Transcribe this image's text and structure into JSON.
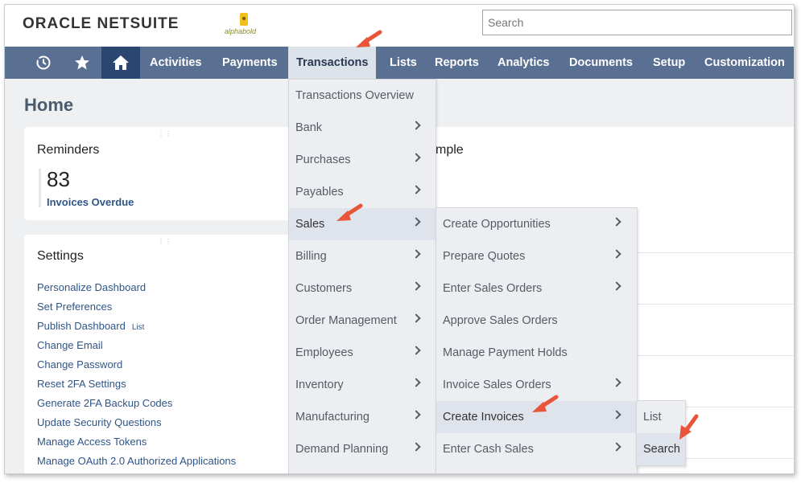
{
  "header": {
    "logo": "ORACLE NETSUITE",
    "partner_logo": "alphabold",
    "search_placeholder": "Search"
  },
  "nav": {
    "items": [
      "Activities",
      "Payments",
      "Transactions",
      "Lists",
      "Reports",
      "Analytics",
      "Documents",
      "Setup",
      "Customization"
    ],
    "active": "Transactions",
    "icons": [
      "recent-icon",
      "star-icon",
      "home-icon"
    ]
  },
  "page": {
    "title": "Home",
    "reminders": {
      "title": "Reminders",
      "count": "83",
      "label": "Invoices Overdue"
    },
    "settings": {
      "title": "Settings",
      "links": [
        "Personalize Dashboard",
        "Set Preferences",
        "Publish Dashboard",
        "Change Email",
        "Change Password",
        "Reset 2FA Settings",
        "Generate 2FA Backup Codes",
        "Update Security Questions",
        "Manage Access Tokens",
        "Manage OAuth 2.0 Authorized Applications"
      ],
      "publish_tag": "List"
    },
    "partial_heading": "mple"
  },
  "transactions_menu": {
    "items": [
      "Transactions Overview",
      "Bank",
      "Purchases",
      "Payables",
      "Sales",
      "Billing",
      "Customers",
      "Order Management",
      "Employees",
      "Inventory",
      "Manufacturing",
      "Demand Planning"
    ],
    "selected": "Sales"
  },
  "sales_menu": {
    "items": [
      "Create Opportunities",
      "Prepare Quotes",
      "Enter Sales Orders",
      "Approve Sales Orders",
      "Manage Payment Holds",
      "Invoice Sales Orders",
      "Create Invoices",
      "Enter Cash Sales"
    ],
    "selected": "Create Invoices"
  },
  "invoices_menu": {
    "items": [
      "List",
      "Search"
    ],
    "selected": "Search"
  },
  "colors": {
    "nav_bg": "#5a7092",
    "nav_home_bg": "#2b4670",
    "link": "#2f5587",
    "arrow": "#e8553a"
  }
}
